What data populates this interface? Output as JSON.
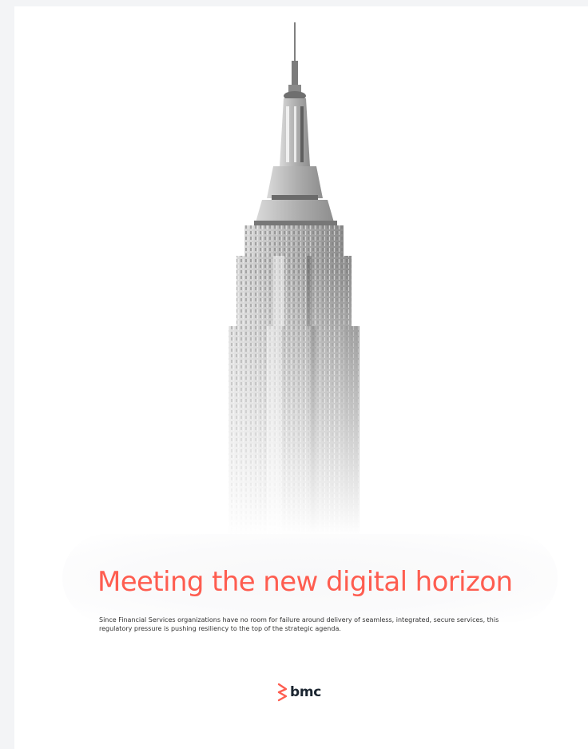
{
  "document": {
    "title": "Meeting the new digital horizon",
    "body": "Since Financial Services organizations have no room for failure around delivery of seamless, integrated, secure services, this regulatory pressure is pushing resiliency to the top of the strategic agenda.",
    "logo_text": "bmc",
    "accent_color": "#fe5d50",
    "logo_text_color": "#1b2530"
  },
  "image": {
    "subject": "skyscraper-in-fog"
  }
}
